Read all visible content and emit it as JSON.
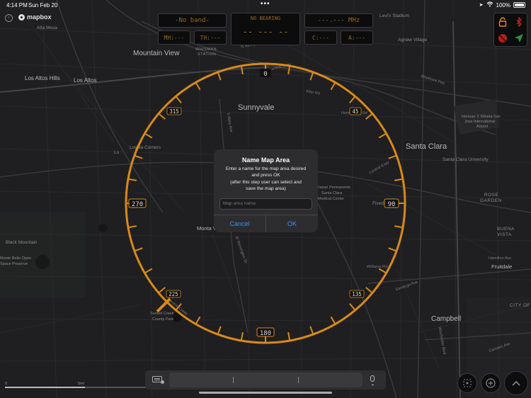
{
  "status_bar": {
    "time": "4:14 PM",
    "date": "Sun Feb 20",
    "battery": "100%",
    "dots": "•••"
  },
  "map": {
    "attribution": "mapbox",
    "cities": [
      {
        "name": "Mountain View"
      },
      {
        "name": "Los Altos Hills"
      },
      {
        "name": "Los Altos"
      },
      {
        "name": "Sunnyvale"
      },
      {
        "name": "Santa Clara"
      },
      {
        "name": "Campbell"
      },
      {
        "name": "Fruitdale"
      },
      {
        "name": "Monta V"
      }
    ],
    "small_labels": [
      "Alta Mesa",
      "Agnew Village",
      "Levi's Stadium",
      "Norman Y. Mineta San",
      "Jose International",
      "Airport",
      "Santa Clara University",
      "ROSE",
      "GARDEN",
      "BUENA",
      "VISTA",
      "Loyola Corners",
      "Kaiser Permanente",
      "Santa Clara",
      "Medical Center",
      "Black Mountain",
      "Monte Bello Open",
      "Space Preserve",
      "Sunset Creek",
      "County Park",
      "CITY OF",
      "WHISMAN",
      "STATION",
      "Fixed",
      "Lo"
    ],
    "road_labels": [
      "Central Expy",
      "Bayshore Fwy",
      "Kifer Rd",
      "Central Expy",
      "S Mary Ave",
      "Homestead Rd",
      "Williams Rd",
      "Saratoga Ave",
      "Winchester Blvd",
      "Camden Ave",
      "Hamilton Ave",
      "W Remington Dr",
      "Stevens Creek",
      "N Sunnyvale Rd"
    ],
    "scale_label": "5mi"
  },
  "lcd": {
    "band": "-No band-",
    "bearing_title": "NO BEARING",
    "bearing_value": "-- --- --",
    "freq": "---.--- MHz",
    "mh": "MH:---",
    "th": "TH:---",
    "c": "C:---",
    "a": "A:---",
    "color": "#9a6a17"
  },
  "compass": {
    "color": "#d88a17",
    "labels": {
      "north": "0",
      "east": "90",
      "south": "180",
      "west": "270",
      "ne": "45",
      "se": "135",
      "sw": "225",
      "nw": "315"
    }
  },
  "controls": {
    "icons": [
      "unlock-icon",
      "bluetooth-icon",
      "no-entry-icon",
      "location-arrow-icon"
    ]
  },
  "dialog": {
    "title": "Name Map Area",
    "message_line1": "Enter a name for the map area desired",
    "message_line2": "and press OK",
    "message_line3": "(after this step user can select and",
    "message_line4": "save the map area)",
    "input_placeholder": "Map area name",
    "input_value": "",
    "cancel_label": "Cancel",
    "ok_label": "OK",
    "accent": "#3a8cf5"
  },
  "bottom_buttons": [
    "recenter-icon",
    "add-icon",
    "chevron-up-icon"
  ]
}
